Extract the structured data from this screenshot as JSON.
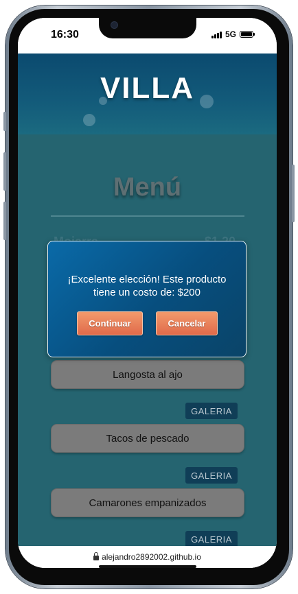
{
  "status_bar": {
    "time": "16:30",
    "network": "5G",
    "signal_icon": "signal-bars-icon",
    "battery_icon": "battery-icon"
  },
  "header": {
    "brand": "VILLA"
  },
  "menu": {
    "title": "Menú",
    "partial_item_name": "Mojarra",
    "partial_item_price": "$1,20"
  },
  "dishes": [
    {
      "name": "Langosta al ajo",
      "gallery_label": "GALERIA"
    },
    {
      "name": "Tacos de pescado",
      "gallery_label": "GALERIA"
    },
    {
      "name": "Camarones empanizados",
      "gallery_label": "GALERIA"
    }
  ],
  "modal": {
    "message": "¡Excelente elección! Este producto tiene un costo de: $200",
    "continue_label": "Continuar",
    "cancel_label": "Cancelar"
  },
  "browser": {
    "url": "alejandro2892002.github.io",
    "lock_icon": "lock-icon"
  },
  "colors": {
    "header_bg": "#0b4a6f",
    "content_bg": "#256470",
    "modal_bg": "#074e7e",
    "button_accent": "#e8784f",
    "dish_bg": "#7b7b7b",
    "gallery_bg": "#103e57"
  }
}
